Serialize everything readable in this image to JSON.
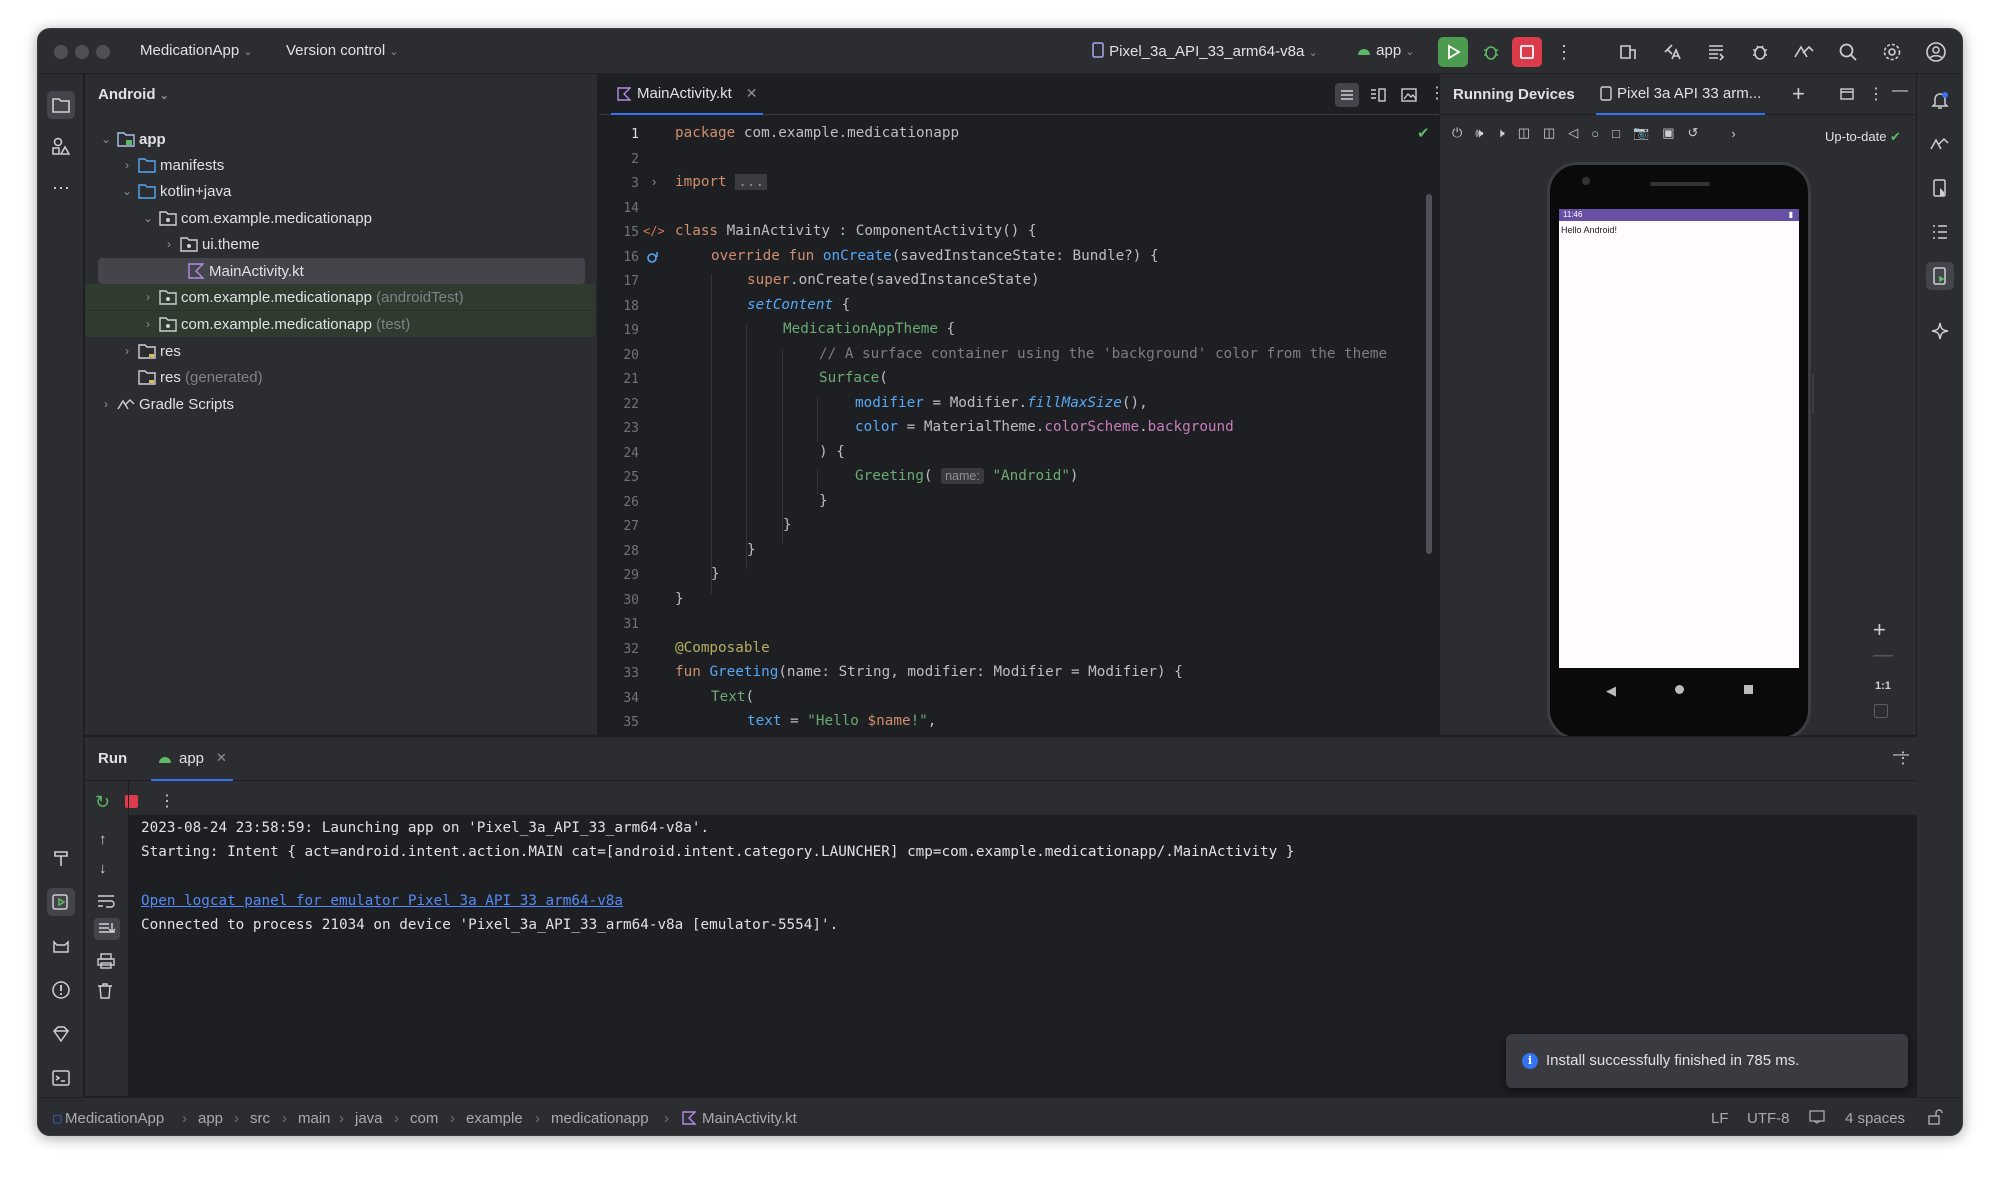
{
  "titlebar": {
    "project_name": "MedicationApp",
    "vcs_label": "Version control",
    "device_selector": "Pixel_3a_API_33_arm64-v8a",
    "run_config": "app"
  },
  "project_panel": {
    "view_label": "Android",
    "tree": [
      {
        "label": "app",
        "suffix": ""
      },
      {
        "label": "manifests",
        "suffix": ""
      },
      {
        "label": "kotlin+java",
        "suffix": ""
      },
      {
        "label": "com.example.medicationapp",
        "suffix": ""
      },
      {
        "label": "ui.theme",
        "suffix": ""
      },
      {
        "label": "MainActivity.kt",
        "suffix": ""
      },
      {
        "label": "com.example.medicationapp",
        "suffix": "(androidTest)"
      },
      {
        "label": "com.example.medicationapp",
        "suffix": "(test)"
      },
      {
        "label": "res",
        "suffix": ""
      },
      {
        "label": "res",
        "suffix": "(generated)"
      },
      {
        "label": "Gradle Scripts",
        "suffix": ""
      }
    ]
  },
  "editor": {
    "tab_label": "MainActivity.kt",
    "line_numbers": [
      "1",
      "2",
      "3",
      "14",
      "15",
      "16",
      "17",
      "18",
      "19",
      "20",
      "21",
      "22",
      "23",
      "24",
      "25",
      "26",
      "27",
      "28",
      "29",
      "30",
      "31",
      "32",
      "33",
      "34",
      "35"
    ],
    "code": {
      "l1_kw": "package",
      "l1_rest": " com.example.medicationapp",
      "l3_kw": "import",
      "l3_fold": "...",
      "l15_a": "class",
      "l15_b": " MainActivity : ComponentActivity() {",
      "l16_a": "override fun ",
      "l16_b": "onCreate",
      "l16_c": "(savedInstanceState: Bundle?) {",
      "l17_a": "super",
      "l17_b": ".onCreate(savedInstanceState)",
      "l18_a": "setContent",
      "l18_b": " {",
      "l19_a": "MedicationAppTheme",
      "l19_b": " {",
      "l20": "// A surface container using the 'background' color from the theme",
      "l21_a": "Surface",
      "l21_b": "(",
      "l22_a": "modifier",
      "l22_b": " = Modifier.",
      "l22_c": "fillMaxSize",
      "l22_d": "(),",
      "l23_a": "color",
      "l23_b": " = MaterialTheme.",
      "l23_c": "colorScheme",
      "l23_d": ".",
      "l23_e": "background",
      "l24": ") {",
      "l25_a": "Greeting",
      "l25_b": "(",
      "l25_hint": "name:",
      "l25_c": "\"Android\"",
      "l25_d": ")",
      "l26": "}",
      "l27": "}",
      "l28": "}",
      "l29": "}",
      "l30": "}",
      "l32": "@Composable",
      "l33_a": "fun ",
      "l33_b": "Greeting",
      "l33_c": "(name: String, modifier: Modifier = Modifier) {",
      "l34_a": "Text",
      "l34_b": "(",
      "l35_a": "text",
      "l35_b": " = ",
      "l35_c": "\"Hello ",
      "l35_d": "$name",
      "l35_e": "!\"",
      "l35_f": ","
    }
  },
  "devices_panel": {
    "title": "Running Devices",
    "tab_label": "Pixel 3a API 33 arm...",
    "status": "Up-to-date",
    "phone_time": "11:46",
    "phone_text": "Hello Android!",
    "zoom_label": "1:1"
  },
  "run_panel": {
    "title": "Run",
    "tab_label": "app",
    "lines": [
      "2023-08-24 23:58:59: Launching app on 'Pixel_3a_API_33_arm64-v8a'.",
      "Starting: Intent { act=android.intent.action.MAIN cat=[android.intent.category.LAUNCHER] cmp=com.example.medicationapp/.MainActivity }",
      "Open logcat panel for emulator Pixel 3a API 33 arm64-v8a",
      "Connected to process 21034 on device 'Pixel_3a_API_33_arm64-v8a [emulator-5554]'."
    ]
  },
  "toast": {
    "message": "Install successfully finished in 785 ms."
  },
  "statusbar": {
    "breadcrumbs": [
      "MedicationApp",
      "app",
      "src",
      "main",
      "java",
      "com",
      "example",
      "medicationapp",
      "MainActivity.kt"
    ],
    "line_sep": "LF",
    "encoding": "UTF-8",
    "indent": "4 spaces"
  },
  "colors": {
    "accent": "#3574f0",
    "run_green": "#4c9b4f",
    "stop_red": "#db3b4b",
    "selection": "#43454a"
  }
}
